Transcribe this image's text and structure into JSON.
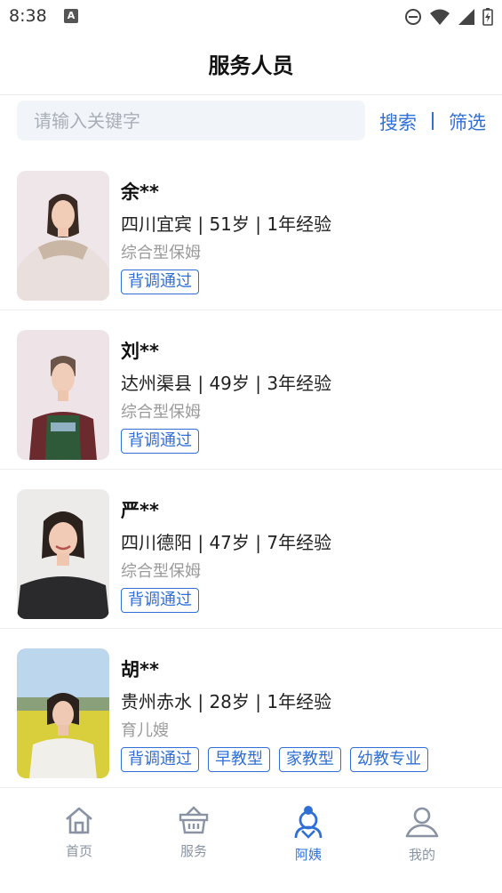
{
  "status_bar": {
    "time": "8:38",
    "notice": "A"
  },
  "header": {
    "title": "服务人员"
  },
  "search": {
    "placeholder": "请输入关键字",
    "search_label": "搜索",
    "filter_label": "筛选"
  },
  "workers": [
    {
      "name": "余**",
      "info": "四川宜宾 | 51岁 | 1年经验",
      "role": "综合型保姆",
      "tags": [
        "背调通过"
      ]
    },
    {
      "name": "刘**",
      "info": "达州渠县 | 49岁 | 3年经验",
      "role": "综合型保姆",
      "tags": [
        "背调通过"
      ]
    },
    {
      "name": "严**",
      "info": "四川德阳 | 47岁 | 7年经验",
      "role": "综合型保姆",
      "tags": [
        "背调通过"
      ]
    },
    {
      "name": "胡**",
      "info": "贵州赤水 | 28岁 | 1年经验",
      "role": "育儿嫂",
      "tags": [
        "背调通过",
        "早教型",
        "家教型",
        "幼教专业"
      ]
    }
  ],
  "tabbar": {
    "items": [
      {
        "label": "首页",
        "icon": "home-icon",
        "active": false
      },
      {
        "label": "服务",
        "icon": "basket-icon",
        "active": false
      },
      {
        "label": "阿姨",
        "icon": "nanny-icon",
        "active": true
      },
      {
        "label": "我的",
        "icon": "user-icon",
        "active": false
      }
    ]
  },
  "colors": {
    "accent": "#2f6fd6",
    "inactive": "#8a93a3",
    "search_bg": "#f1f4f9"
  }
}
